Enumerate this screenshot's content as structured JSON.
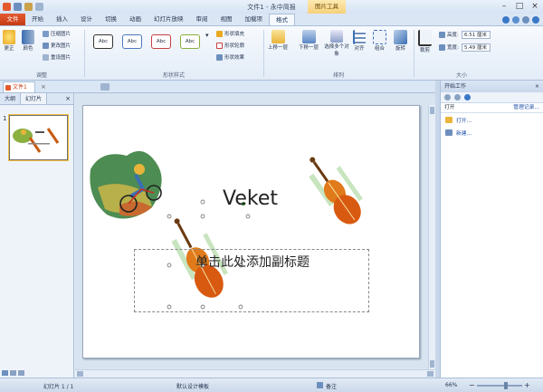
{
  "window": {
    "title": "文件1 - 永中简报",
    "context_tab": "图片工具"
  },
  "tabs": [
    "文件",
    "开始",
    "插入",
    "设计",
    "切换",
    "动画",
    "幻灯片放映",
    "审阅",
    "视图",
    "加载项",
    "格式"
  ],
  "ribbon": {
    "adjust": {
      "label": "调整",
      "brightness": "更正",
      "color": "颜色",
      "compress": "压缩图片",
      "change": "更改图片",
      "reset": "重设图片"
    },
    "shape_style": {
      "label": "形状样式",
      "styles": [
        "Abc",
        "Abc",
        "Abc",
        "Abc"
      ],
      "fill": "形状填充",
      "outline": "形状轮廓",
      "effect": "形状效果"
    },
    "arrange": {
      "label": "排列",
      "bring_forward": "上移一层",
      "send_backward": "下移一层",
      "select_multi": "选择多个对象",
      "align": "对齐",
      "group": "组合",
      "rotate": "旋转"
    },
    "size": {
      "label": "大小",
      "crop": "裁剪",
      "height_label": "高度:",
      "height": "6.51 厘米",
      "width_label": "宽度:",
      "width": "5.49 厘米"
    }
  },
  "doc_tab": "文件1",
  "left_panel": {
    "tab_outline": "大纲",
    "tab_slides": "幻灯片",
    "slide_number": "1"
  },
  "slide": {
    "title": "Veket",
    "subtitle": "单击此处添加副标题"
  },
  "task_pane": {
    "title": "开始工作",
    "open_label": "打开",
    "manage": "管理记录...",
    "open_link": "打开...",
    "new_link": "新建..."
  },
  "status": {
    "slide_info": "幻灯片 1 / 1",
    "template": "默认设计模板",
    "notes": "备注",
    "zoom": "66%"
  },
  "colors": {
    "accent": "#e45a2f",
    "ribbon_bg": "#e3ecf7",
    "link": "#1e4fa8"
  }
}
